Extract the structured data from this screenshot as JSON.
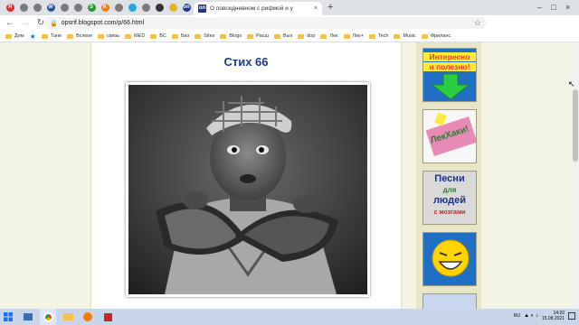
{
  "browser": {
    "active_tab_title": "О повседневном с рифмой и у",
    "new_tab_glyph": "+",
    "url": "opsrif.blogspot.com/p/66.html",
    "colors": {
      "tabstrip": "#dee1e6",
      "toolbar": "#ffffff"
    }
  },
  "tabs_icons": [
    {
      "name": "yandex-favicon",
      "color": "#e2262b",
      "glyph": "Я"
    },
    {
      "name": "site-favicon-gray",
      "color": "#7a7a7a",
      "glyph": ""
    },
    {
      "name": "site-favicon-gray",
      "color": "#7a7a7a",
      "glyph": ""
    },
    {
      "name": "word-favicon",
      "color": "#2b579a",
      "glyph": "W"
    },
    {
      "name": "site-favicon-gray",
      "color": "#7a7a7a",
      "glyph": ""
    },
    {
      "name": "site-favicon-gray",
      "color": "#7a7a7a",
      "glyph": ""
    },
    {
      "name": "sber-favicon",
      "color": "#1a9f29",
      "glyph": "S"
    },
    {
      "name": "site-favicon-orange",
      "color": "#f07d16",
      "glyph": "K"
    },
    {
      "name": "site-favicon-gray",
      "color": "#7a7a7a",
      "glyph": ""
    },
    {
      "name": "telegram-favicon",
      "color": "#2aa3df",
      "glyph": ""
    },
    {
      "name": "site-favicon-gray",
      "color": "#7a7a7a",
      "glyph": ""
    },
    {
      "name": "dark-favicon",
      "color": "#333333",
      "glyph": ""
    },
    {
      "name": "yellow-favicon",
      "color": "#e3b420",
      "glyph": ""
    },
    {
      "name": "blog-favicon",
      "color": "#1b3a8c",
      "glyph": "on"
    }
  ],
  "bookmarks": [
    {
      "label": "Дом",
      "type": "folder"
    },
    {
      "label": "",
      "type": "star"
    },
    {
      "label": "Тане",
      "type": "folder"
    },
    {
      "label": "Всякое",
      "type": "folder"
    },
    {
      "label": "связь",
      "type": "folder"
    },
    {
      "label": "MED",
      "type": "folder"
    },
    {
      "label": "BC",
      "type": "folder"
    },
    {
      "label": "Биз",
      "type": "folder"
    },
    {
      "label": "Sites",
      "type": "folder"
    },
    {
      "label": "Blogs",
      "type": "folder"
    },
    {
      "label": "Расш",
      "type": "folder"
    },
    {
      "label": "Вых",
      "type": "folder"
    },
    {
      "label": "dop",
      "type": "folder"
    },
    {
      "label": "Лек",
      "type": "folder"
    },
    {
      "label": "Лек+",
      "type": "folder"
    },
    {
      "label": "Tech",
      "type": "folder"
    },
    {
      "label": "Music",
      "type": "folder"
    },
    {
      "label": "Фриланс",
      "type": "folder"
    }
  ],
  "post": {
    "title": "Стих 66",
    "photo_alt_icon": "photo-man-with-watermelon"
  },
  "sidebar": {
    "tiles": [
      {
        "name": "interesting-useful-banner",
        "line1": "Интересно",
        "line2": "и полезно!",
        "bg": "#1f6fc4"
      },
      {
        "name": "lekhaki-banner",
        "line1": "ЛекХаки!",
        "bg": "#f7f7f7"
      },
      {
        "name": "songs-banner",
        "line1": "Песни",
        "line2": "для",
        "line3": "людей",
        "line4": "с мозгами",
        "bg": "#d9d9d9"
      },
      {
        "name": "smiley-banner",
        "bg": "#1f6fc4"
      }
    ]
  },
  "taskbar": {
    "lang": "RU",
    "time": "14:20",
    "date": "15.08.2021"
  }
}
